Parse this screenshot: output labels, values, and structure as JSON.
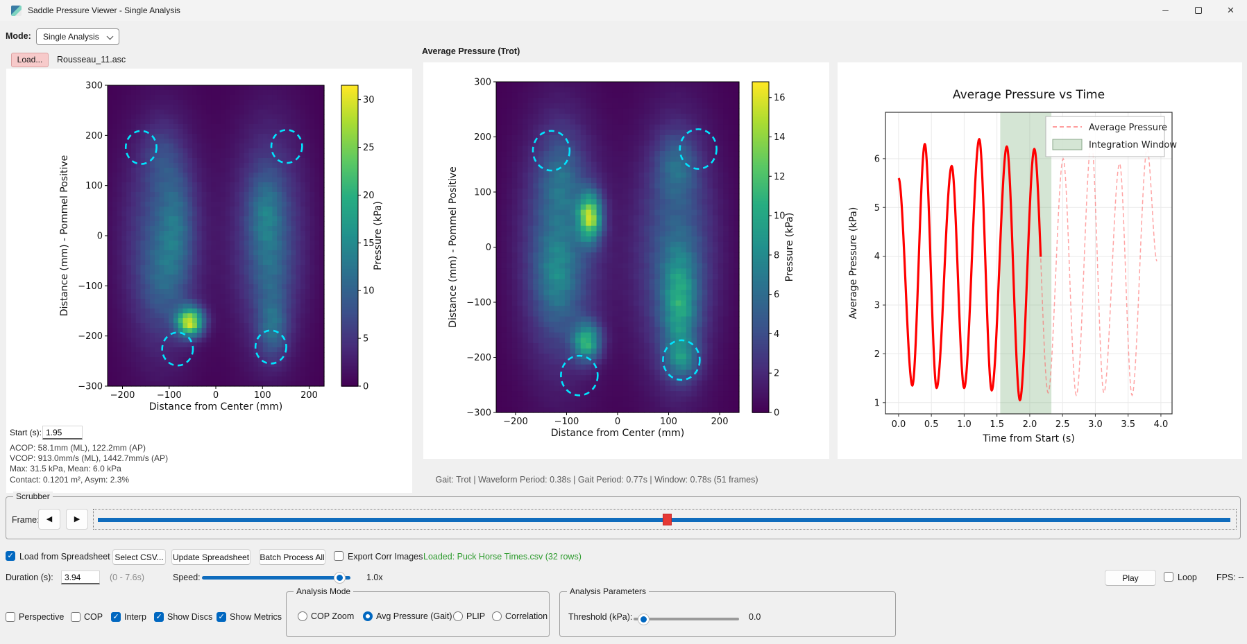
{
  "window": {
    "title": "Saddle Pressure Viewer - Single Analysis",
    "icons": {
      "minimize": "─",
      "maximize": "maximize-box",
      "close": "×"
    }
  },
  "mode_row": {
    "label": "Mode:",
    "value": "Single Analysis"
  },
  "load_row": {
    "button": "Load...",
    "filename": "Rousseau_11.asc"
  },
  "left_panel": {
    "start_label": "Start (s):",
    "start_value": "1.95",
    "stats_lines": [
      "ACOP: 58.1mm (ML), 122.2mm (AP)",
      "VCOP: 913.0mm/s (ML), 1442.7mm/s (AP)",
      "Max: 31.5 kPa, Mean: 6.0 kPa",
      "Contact: 0.1201 m², Asym: 2.3%"
    ]
  },
  "mid_panel": {
    "title": "Average Pressure (Trot)"
  },
  "status_line": "Gait: Trot | Waveform Period: 0.38s | Gait Period: 0.77s | Window: 0.78s (51 frames)",
  "scrubber": {
    "label": "Scrubber",
    "frame_label": "Frame:",
    "prev_icon": "◀",
    "next_icon": "▶",
    "position_fraction": 0.502
  },
  "spreadsheet_row": {
    "load_checkbox": {
      "label": "Load from Spreadsheet",
      "checked": true
    },
    "select_csv": "Select CSV...",
    "update": "Update Spreadsheet",
    "batch": "Batch Process All",
    "export_corr": {
      "label": "Export Corr Images",
      "checked": false
    },
    "loaded_status": "Loaded: Puck Horse Times.csv (32 rows)"
  },
  "duration_row": {
    "label": "Duration (s):",
    "value": "3.94",
    "range_hint": "(0 - 7.6s)",
    "speed_label": "Speed:",
    "speed_value": "1.0x",
    "speed_fraction": 0.96
  },
  "playback": {
    "play": "Play",
    "loop": {
      "label": "Loop",
      "checked": false
    },
    "fps": "FPS: --"
  },
  "view_toggles": [
    {
      "label": "Perspective",
      "checked": false
    },
    {
      "label": "COP",
      "checked": false
    },
    {
      "label": "Interp",
      "checked": true
    },
    {
      "label": "Show Discs",
      "checked": true
    },
    {
      "label": "Show Metrics",
      "checked": true
    }
  ],
  "analysis_mode": {
    "label": "Analysis Mode",
    "options": [
      {
        "label": "COP Zoom",
        "selected": false
      },
      {
        "label": "Avg Pressure (Gait)",
        "selected": true
      },
      {
        "label": "PLIP",
        "selected": false
      },
      {
        "label": "Correlation",
        "selected": false
      }
    ]
  },
  "analysis_params": {
    "label": "Analysis Parameters",
    "threshold_label": "Threshold (kPa):",
    "threshold_value": "0.0",
    "threshold_fraction": 0.05
  },
  "colors": {
    "accent": "#0067c0",
    "scrubber_track": "#0f6cbd",
    "scrubber_handle": "#e53935",
    "loaded_text": "#2e9b2e",
    "solid_line": "#ff0000",
    "dashed_line": "rgba(255,90,90,0.55)",
    "window_fill": "rgba(120,175,120,0.32)",
    "disc": "#00e5ff"
  },
  "chart_data": [
    {
      "type": "heatmap",
      "name": "frame-pressure-map",
      "xlabel": "Distance from Center (mm)",
      "ylabel": "Distance (mm) - Pommel Positive",
      "x_range": [
        -232,
        232
      ],
      "y_range": [
        -300,
        300
      ],
      "x_ticks": [
        -200,
        -100,
        0,
        100,
        200
      ],
      "y_ticks": [
        300,
        200,
        100,
        0,
        -100,
        -200,
        -300
      ],
      "colormap": "viridis",
      "vmax": 31.5,
      "colorbar": {
        "label": "Pressure (kPa)",
        "ticks": [
          0,
          5,
          10,
          15,
          20,
          25,
          30
        ]
      },
      "grid": [
        46,
        62
      ],
      "pressure_blobs": [
        [
          -116,
          -10,
          58,
          158,
          8.2
        ],
        [
          114,
          -5,
          56,
          158,
          8.2
        ],
        [
          -55,
          -172,
          20,
          20,
          27
        ],
        [
          -85,
          15,
          26,
          85,
          6
        ],
        [
          108,
          45,
          25,
          55,
          6.5
        ],
        [
          122,
          -185,
          22,
          42,
          8
        ],
        [
          118,
          -75,
          26,
          50,
          3.5
        ],
        [
          -118,
          160,
          26,
          45,
          3
        ],
        [
          -120,
          -90,
          30,
          60,
          3
        ]
      ],
      "discs": [
        [
          -160,
          176,
          33
        ],
        [
          152,
          178,
          33
        ],
        [
          -82,
          -226,
          33
        ],
        [
          118,
          -222,
          33
        ]
      ]
    },
    {
      "type": "heatmap",
      "name": "average-pressure-map-trot",
      "xlabel": "Distance from Center (mm)",
      "ylabel": "Distance (mm) - Pommel Positive",
      "x_range": [
        -238,
        238
      ],
      "y_range": [
        -300,
        300
      ],
      "x_ticks": [
        -200,
        -100,
        0,
        100,
        200
      ],
      "y_ticks": [
        300,
        200,
        100,
        0,
        -100,
        -200,
        -300
      ],
      "colormap": "viridis",
      "vmax": 16.8,
      "colorbar": {
        "label": "Pressure (kPa)",
        "ticks": [
          0,
          2,
          4,
          6,
          8,
          10,
          12,
          14,
          16
        ]
      },
      "grid": [
        46,
        62
      ],
      "pressure_blobs": [
        [
          -112,
          0,
          56,
          160,
          5
        ],
        [
          114,
          -10,
          56,
          160,
          5
        ],
        [
          -54,
          55,
          16,
          30,
          12.5
        ],
        [
          -60,
          -172,
          19,
          24,
          9.5
        ],
        [
          -112,
          125,
          28,
          55,
          3
        ],
        [
          122,
          -105,
          24,
          70,
          6.5
        ],
        [
          116,
          148,
          27,
          40,
          3.5
        ],
        [
          -120,
          -50,
          28,
          60,
          3.5
        ],
        [
          126,
          -205,
          22,
          24,
          4.5
        ]
      ],
      "discs": [
        [
          -130,
          175,
          36
        ],
        [
          158,
          178,
          36
        ],
        [
          -75,
          -233,
          36
        ],
        [
          125,
          -205,
          36
        ]
      ]
    },
    {
      "type": "line",
      "title": "Average Pressure vs Time",
      "xlabel": "Time from Start (s)",
      "ylabel": "Average Pressure (kPa)",
      "x_ticks": [
        0,
        0.5,
        1,
        1.5,
        2,
        2.5,
        3,
        3.5,
        4
      ],
      "y_ticks": [
        1,
        2,
        3,
        4,
        5,
        6
      ],
      "x_range": [
        -0.2,
        4.17
      ],
      "y_range": [
        0.77,
        6.95
      ],
      "legend": [
        "Average Pressure",
        "Integration Window"
      ],
      "grid": true,
      "integration_window": [
        1.55,
        2.33
      ],
      "solid_until": 2.17,
      "keypoints": [
        [
          0,
          5.6
        ],
        [
          0.21,
          1.35
        ],
        [
          0.4,
          6.3
        ],
        [
          0.58,
          1.3
        ],
        [
          0.81,
          5.85
        ],
        [
          1,
          1.3
        ],
        [
          1.23,
          6.4
        ],
        [
          1.42,
          1.25
        ],
        [
          1.65,
          6.25
        ],
        [
          1.85,
          1.05
        ],
        [
          2.07,
          6.2
        ],
        [
          2.28,
          1.2
        ],
        [
          2.51,
          6.0
        ],
        [
          2.71,
          1.15
        ],
        [
          2.94,
          6.35
        ],
        [
          3.13,
          1.2
        ],
        [
          3.37,
          5.9
        ],
        [
          3.56,
          1.15
        ],
        [
          3.79,
          6.2
        ],
        [
          3.94,
          3.9
        ]
      ]
    }
  ]
}
